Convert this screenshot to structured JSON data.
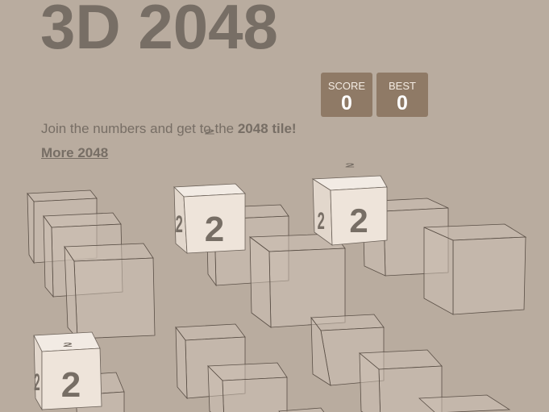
{
  "game": {
    "title": "3D 2048",
    "intro_prefix": "Join the numbers and get to the ",
    "intro_bold": "2048 tile!",
    "more_link": "More 2048"
  },
  "scores": {
    "score_label": "SCORE",
    "score_value": "0",
    "best_label": "BEST",
    "best_value": "0"
  },
  "tiles": [
    {
      "value": "2"
    },
    {
      "value": "2"
    },
    {
      "value": "2"
    }
  ],
  "colors": {
    "background": "#b9ac9f",
    "text": "#776e65",
    "score_box": "#8f7a66",
    "tile_2": "#eee4da"
  }
}
